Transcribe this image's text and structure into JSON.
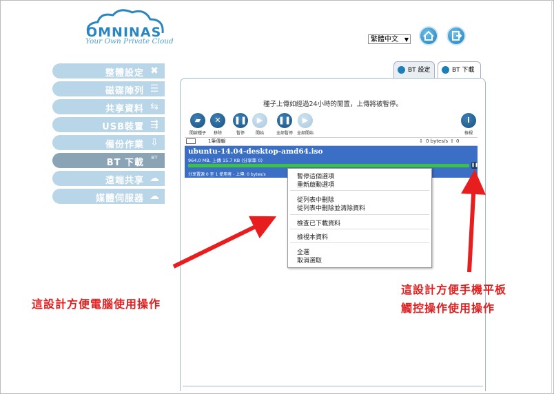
{
  "logo": {
    "name": "OMNINAS",
    "tagline": "Your Own Private Cloud"
  },
  "header": {
    "language": "繁體中文",
    "home_icon": "home-icon",
    "logout_icon": "exit-icon"
  },
  "sidebar": {
    "items": [
      {
        "label": "整體設定",
        "icon": "tools-icon"
      },
      {
        "label": "磁碟陣列",
        "icon": "disk-icon"
      },
      {
        "label": "共享資料",
        "icon": "share-arrows-icon"
      },
      {
        "label": "USB裝置",
        "icon": "usb-icon"
      },
      {
        "label": "備份作業",
        "icon": "backup-icon"
      },
      {
        "label": "BT 下載",
        "icon": "bt-icon",
        "badge": "BT"
      },
      {
        "label": "遠端共享",
        "icon": "remote-share-icon"
      },
      {
        "label": "媒體伺服器",
        "icon": "media-server-icon"
      }
    ],
    "active_index": 5
  },
  "tabs": [
    {
      "label": "BT 設定"
    },
    {
      "label": "BT 下載"
    }
  ],
  "notice": "種子上傳如經過24小時的閒置，上傳將被暫停。",
  "toolbar": {
    "buttons": [
      {
        "label": "開啟種子",
        "icon": "folder-open-icon"
      },
      {
        "label": "移除",
        "icon": "close-icon"
      },
      {
        "label": "暫停",
        "icon": "pause-icon"
      },
      {
        "label": "開始",
        "icon": "play-icon"
      },
      {
        "label": "全部暫停",
        "icon": "pause-all-icon"
      },
      {
        "label": "全部開始",
        "icon": "play-all-icon"
      },
      {
        "label": "檢視",
        "icon": "info-icon"
      }
    ]
  },
  "listbar": {
    "count": "1筆傳輸",
    "down_speed": "0 bytes/s",
    "up_speed": "0 bytes/s"
  },
  "task": {
    "name": "ubuntu-14.04-desktop-amd64.iso",
    "info": "964.0 MB, 上傳 15.7 KB (分享率 0)",
    "peers": "分享置源 0 至 1 使用者 - 上傳: 0 bytes/s",
    "progress": 1.0
  },
  "context_menu": {
    "items": [
      "暫停這個選項",
      "重新啟動選項",
      "從列表中刪除",
      "從列表中刪除並清除資料",
      "檢查已下載資料",
      "檢視本資料",
      "全選",
      "取消選取"
    ]
  },
  "callouts": {
    "left": "這設計方便電腦使用操作",
    "right_line1": "這設計方便手機平板",
    "right_line2": "觸控操作使用操作"
  },
  "colors": {
    "accent": "#1e7fb8",
    "sidebar": "#b9d6e8",
    "sidebar_active": "#8aa3b5",
    "task_bg": "#3a6fc5",
    "progress": "#3cc04a",
    "callout": "#e02020"
  }
}
